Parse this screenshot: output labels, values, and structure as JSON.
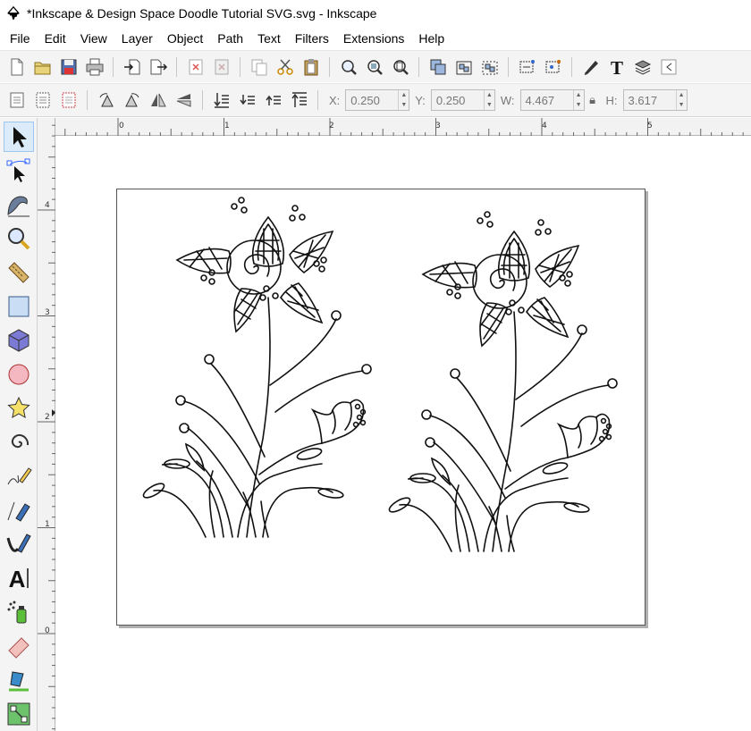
{
  "window": {
    "title": "*Inkscape & Design Space Doodle Tutorial SVG.svg - Inkscape"
  },
  "menu": [
    {
      "label": "File"
    },
    {
      "label": "Edit"
    },
    {
      "label": "View"
    },
    {
      "label": "Layer"
    },
    {
      "label": "Object"
    },
    {
      "label": "Path"
    },
    {
      "label": "Text"
    },
    {
      "label": "Filters"
    },
    {
      "label": "Extensions"
    },
    {
      "label": "Help"
    }
  ],
  "commands_bar": {
    "icons": [
      "new-icon",
      "open-icon",
      "save-icon",
      "print-icon",
      "import-icon",
      "export-icon",
      "undo-icon",
      "redo-icon",
      "copy-icon",
      "cut-icon",
      "paste-icon",
      "zoom-selection-icon",
      "zoom-drawing-icon",
      "zoom-page-icon",
      "duplicate-icon",
      "group-icon",
      "ungroup-icon",
      "fill-stroke-icon",
      "text-font-icon",
      "layers-icon"
    ]
  },
  "controls_bar": {
    "x_label": "X:",
    "x_value": "0.250",
    "y_label": "Y:",
    "y_value": "0.250",
    "w_label": "W:",
    "w_value": "4.467",
    "h_label": "H:",
    "h_value": "3.617",
    "lock_icon": "lock-icon"
  },
  "rulers": {
    "horizontal_labels": [
      "0",
      "1",
      "2",
      "3",
      "4",
      "5"
    ],
    "vertical_labels": [
      "4",
      "3",
      "2",
      "1",
      "0"
    ]
  },
  "toolbox": {
    "active": "selector-tool",
    "tools": [
      "selector-tool",
      "node-tool",
      "tweak-tool",
      "zoom-tool",
      "measure-tool",
      "rect-tool",
      "box3d-tool",
      "ellipse-tool",
      "star-tool",
      "spiral-tool",
      "pencil-tool",
      "pen-tool",
      "calligraphy-tool",
      "text-tool",
      "spray-tool",
      "eraser-tool",
      "paint-bucket-tool",
      "connector-tool"
    ]
  },
  "colors": {
    "chrome": "#f4f4f4",
    "active_tool": "#dcebfa",
    "page_border": "#555555",
    "page_shadow": "#b0b0b0"
  }
}
